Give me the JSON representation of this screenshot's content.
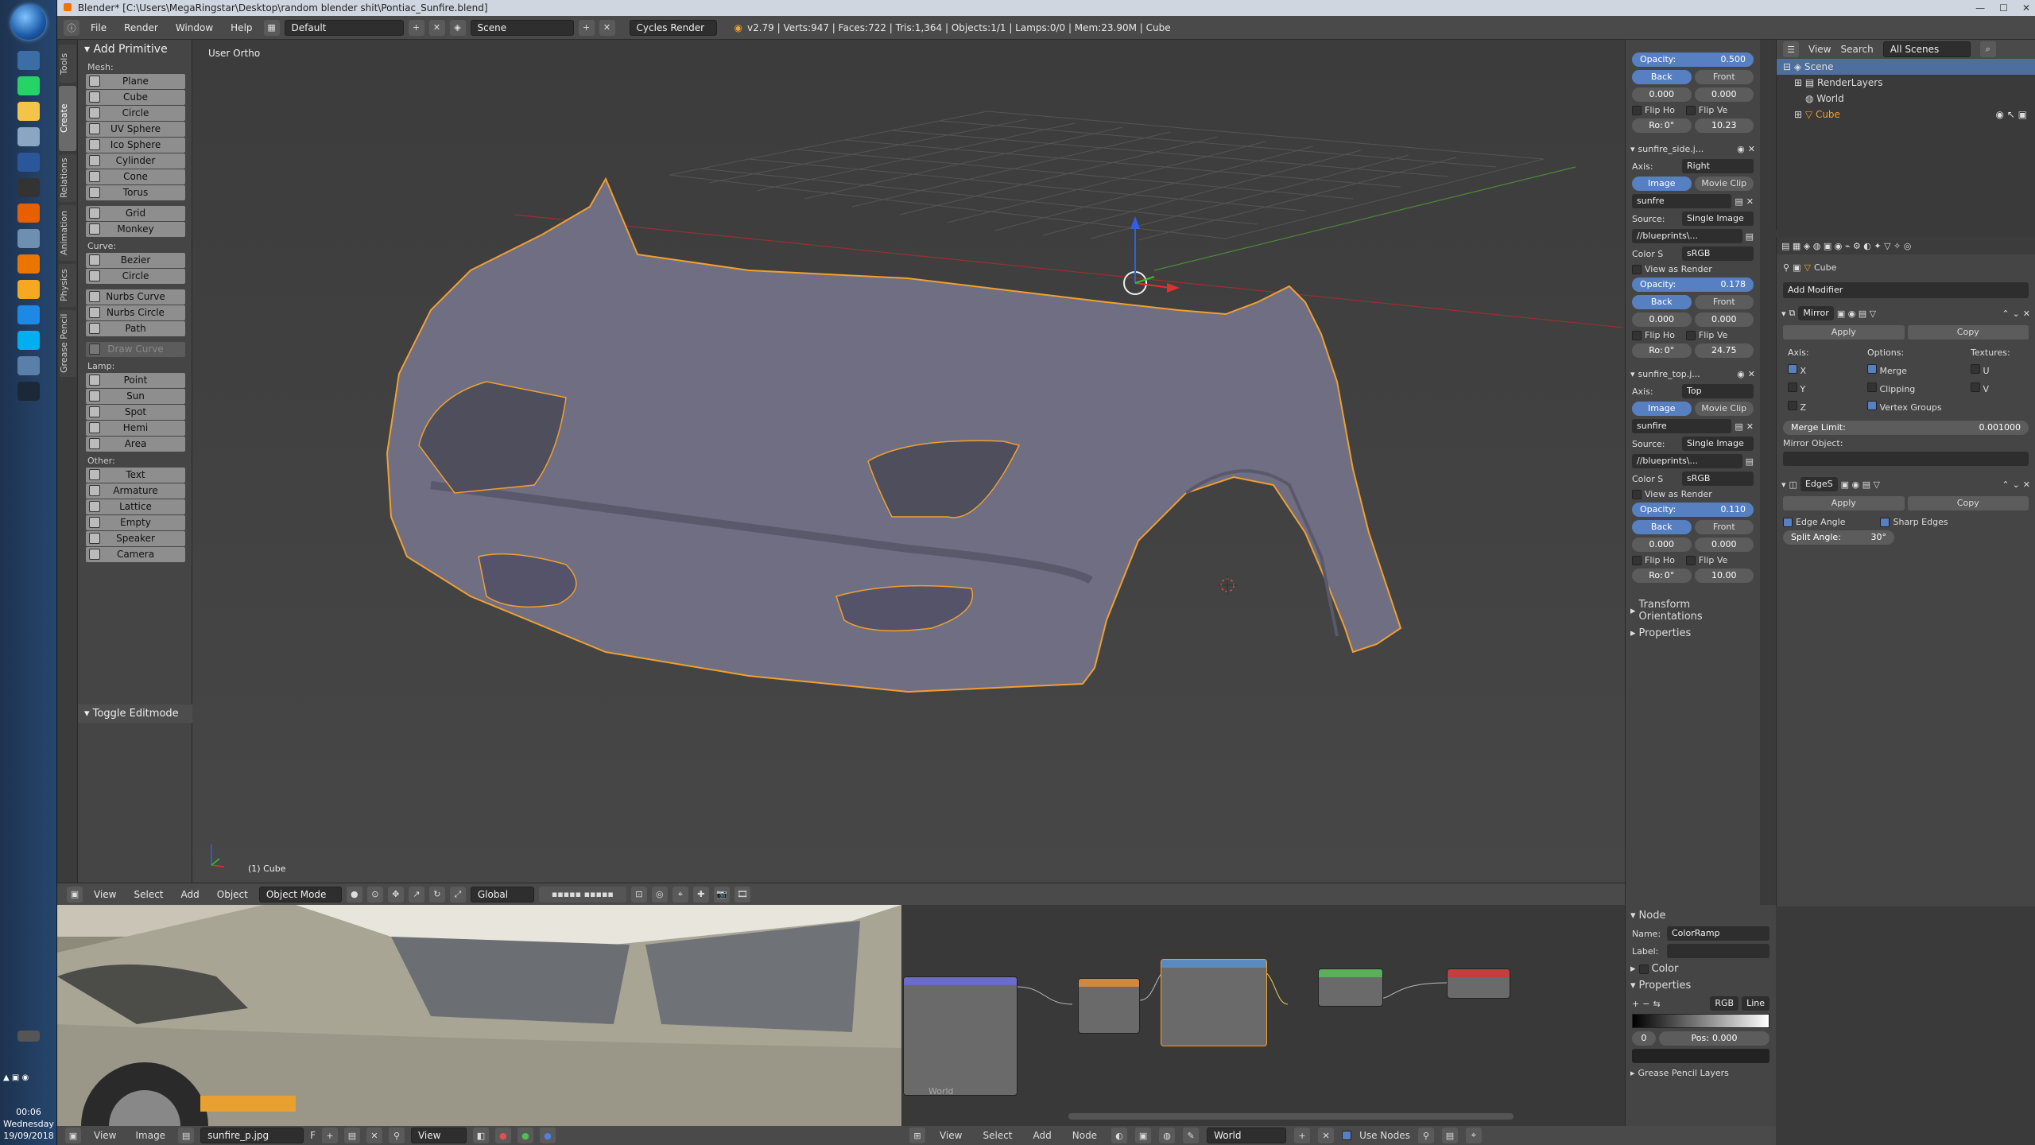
{
  "window": {
    "title": "Blender* [C:\\Users\\MegaRingstar\\Desktop\\random blender shit\\Pontiac_Sunfire.blend]"
  },
  "taskbar": {
    "clock_time": "00:06",
    "clock_day": "Wednesday",
    "clock_date": "19/09/2018"
  },
  "header": {
    "menus": [
      "File",
      "Render",
      "Window",
      "Help"
    ],
    "layout": "Default",
    "scene": "Scene",
    "engine": "Cycles Render",
    "stats": "v2.79 | Verts:947 | Faces:722 | Tris:1,364 | Objects:1/1 | Lamps:0/0 | Mem:23.90M | Cube"
  },
  "tool_tabs": [
    "Tools",
    "Create",
    "Relations",
    "Animation",
    "Physics",
    "Grease Pencil"
  ],
  "toolshelf": {
    "title": "Add Primitive",
    "mesh_label": "Mesh:",
    "mesh": [
      "Plane",
      "Cube",
      "Circle",
      "UV Sphere",
      "Ico Sphere",
      "Cylinder",
      "Cone",
      "Torus"
    ],
    "mesh2": [
      "Grid",
      "Monkey"
    ],
    "curve_label": "Curve:",
    "curve": [
      "Bezier",
      "Circle"
    ],
    "curve2": [
      "Nurbs Curve",
      "Nurbs Circle",
      "Path"
    ],
    "draw_curve": "Draw Curve",
    "lamp_label": "Lamp:",
    "lamp": [
      "Point",
      "Sun",
      "Spot",
      "Hemi",
      "Area"
    ],
    "other_label": "Other:",
    "other": [
      "Text",
      "Armature",
      "Lattice",
      "Empty",
      "Speaker",
      "Camera"
    ],
    "toggle_editmode": "Toggle Editmode"
  },
  "viewport": {
    "view_label": "User Ortho",
    "object_label": "(1) Cube"
  },
  "viewport_header": {
    "menus": [
      "View",
      "Select",
      "Add",
      "Object"
    ],
    "mode": "Object Mode",
    "orientation": "Global"
  },
  "properties": {
    "opacity_label": "Opacity:",
    "back": "Back",
    "front": "Front",
    "flip_h": "Flip Ho",
    "flip_v": "Flip Ve",
    "rot_label": "Ro:",
    "rot_value": "0°",
    "axis_label": "Axis:",
    "image": "Image",
    "movie_clip": "Movie Clip",
    "source_label": "Source:",
    "source_value": "Single Image",
    "path_value": "//blueprints\\...",
    "colorspace_label": "Color S",
    "colorspace_value": "sRGB",
    "view_as_render": "View as Render",
    "image_name": "sunfre",
    "image_name2": "sunfire",
    "first": {
      "opacity": "0.500",
      "x": "0.000",
      "y": "0.000",
      "size": "10.23"
    },
    "side": {
      "name": "sunfire_side.j...",
      "axis": "Right",
      "opacity": "0.178",
      "x": "0.000",
      "y": "0.000",
      "size": "24.75"
    },
    "top": {
      "name": "sunfire_top.j...",
      "axis": "Top",
      "opacity": "0.110",
      "x": "0.000",
      "y": "0.000",
      "size": "10.00"
    },
    "transform_orientations": "Transform Orientations",
    "props": "Properties"
  },
  "outliner": {
    "menus": [
      "View",
      "Search"
    ],
    "filter": "All Scenes",
    "items": [
      "Scene",
      "RenderLayers",
      "World",
      "Cube"
    ]
  },
  "modifiers": {
    "object": "Cube",
    "add_modifier": "Add Modifier",
    "mirror": {
      "name": "Mirror",
      "apply": "Apply",
      "copy": "Copy",
      "axis_label": "Axis:",
      "options_label": "Options:",
      "textures_label": "Textures:",
      "x": "X",
      "y": "Y",
      "z": "Z",
      "merge": "Merge",
      "clipping": "Clipping",
      "vertex_groups": "Vertex Groups",
      "u": "U",
      "v": "V",
      "merge_limit_label": "Merge Limit:",
      "merge_limit": "0.001000",
      "mirror_object_label": "Mirror Object:"
    },
    "edgesplit": {
      "name": "EdgeS",
      "apply": "Apply",
      "copy": "Copy",
      "edge_angle": "Edge Angle",
      "sharp_edges": "Sharp Edges",
      "split_angle_label": "Split Angle:",
      "split_angle": "30°"
    }
  },
  "image_editor": {
    "menus": [
      "View",
      "Image"
    ],
    "image": "sunfire_p.jpg",
    "view": "View"
  },
  "node_editor": {
    "menus": [
      "View",
      "Select",
      "Add",
      "Node"
    ],
    "world": "World",
    "use_nodes": "Use Nodes",
    "world_label": "World"
  },
  "node_sidebar": {
    "node_title": "Node",
    "name_label": "Name:",
    "name_value": "ColorRamp",
    "label_label": "Label:",
    "color": "Color",
    "properties": "Properties",
    "mode": "RGB",
    "interp": "Line",
    "index": "0",
    "pos_label": "Pos:",
    "pos_value": "0.000",
    "grease": "Grease Pencil Layers"
  },
  "colors": {
    "accent": "#5680c2",
    "select_orange": "#f0a030",
    "panel": "#454545"
  }
}
